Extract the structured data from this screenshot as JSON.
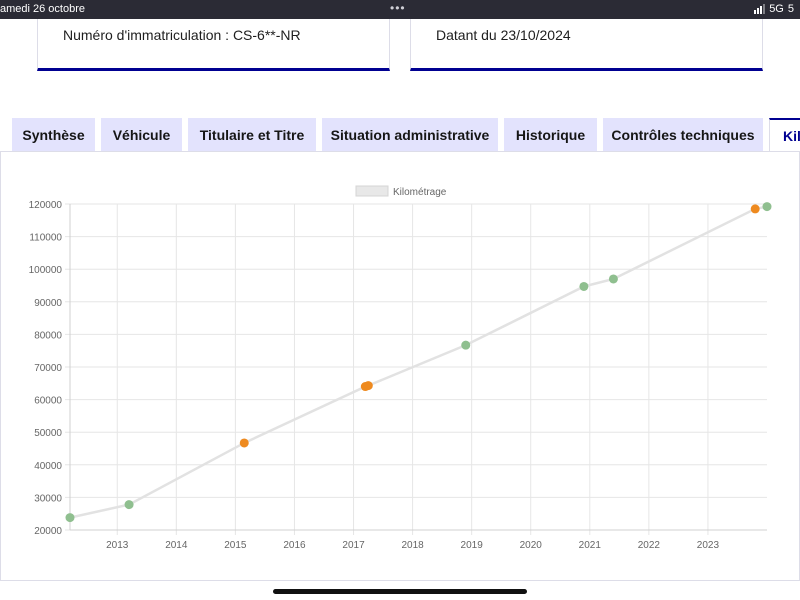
{
  "status_bar": {
    "date": "amedi 26 octobre",
    "dots": "•••",
    "network": "5G",
    "battery": "5"
  },
  "cards": {
    "registration": "Numéro d'immatriculation : CS-6**-NR",
    "dated": "Datant du 23/10/2024"
  },
  "tabs": [
    {
      "label": "Synthèse"
    },
    {
      "label": "Véhicule"
    },
    {
      "label": "Titulaire et Titre"
    },
    {
      "label": "Situation administrative"
    },
    {
      "label": "Historique"
    },
    {
      "label": "Contrôles techniques"
    },
    {
      "label": "Kilométrage"
    }
  ],
  "colors": {
    "accent": "#000091",
    "tab_bg": "#e3e3fd",
    "point_green": "#8fbf8f",
    "point_orange": "#ee8a1f",
    "line": "#e2e2e2"
  },
  "chart_data": {
    "type": "line",
    "legend": "Kilométrage",
    "legend_position": "top-center",
    "grid": true,
    "xlim": [
      2012.2,
      2024.0
    ],
    "ylim": [
      20000,
      120000
    ],
    "x_ticks": [
      "2013",
      "2014",
      "2015",
      "2016",
      "2017",
      "2018",
      "2019",
      "2020",
      "2021",
      "2022",
      "2023"
    ],
    "y_ticks": [
      "20000",
      "30000",
      "40000",
      "50000",
      "60000",
      "70000",
      "80000",
      "90000",
      "100000",
      "110000",
      "120000"
    ],
    "series": [
      {
        "name": "Kilométrage",
        "points": [
          {
            "x": 2012.2,
            "y": 23800,
            "color": "green"
          },
          {
            "x": 2013.2,
            "y": 27800,
            "color": "green"
          },
          {
            "x": 2015.15,
            "y": 46700,
            "color": "orange"
          },
          {
            "x": 2017.2,
            "y": 64000,
            "color": "orange"
          },
          {
            "x": 2017.25,
            "y": 64300,
            "color": "orange"
          },
          {
            "x": 2018.9,
            "y": 76700,
            "color": "green"
          },
          {
            "x": 2020.9,
            "y": 94700,
            "color": "green"
          },
          {
            "x": 2021.4,
            "y": 97000,
            "color": "green"
          },
          {
            "x": 2023.8,
            "y": 118500,
            "color": "orange"
          },
          {
            "x": 2024.0,
            "y": 119200,
            "color": "green"
          }
        ]
      }
    ]
  }
}
